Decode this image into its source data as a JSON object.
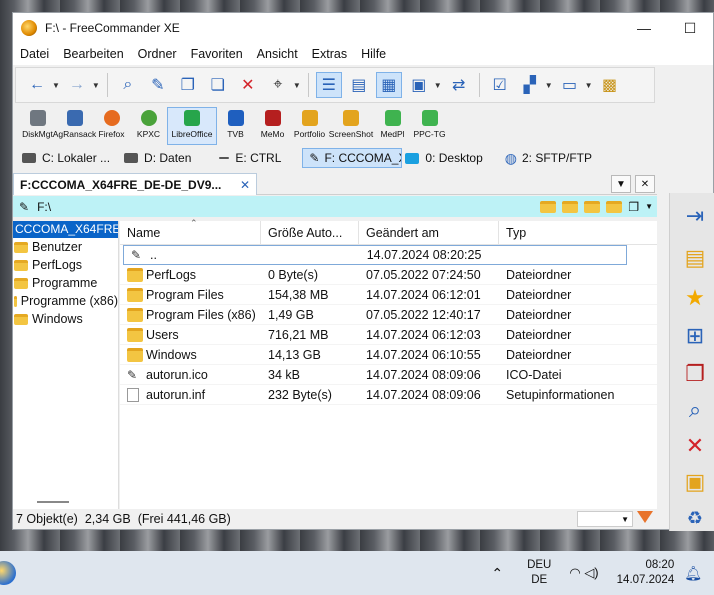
{
  "window": {
    "title": "F:\\ - FreeCommander XE",
    "min": "—",
    "max": "☐"
  },
  "menu": [
    "Datei",
    "Bearbeiten",
    "Ordner",
    "Favoriten",
    "Ansicht",
    "Extras",
    "Hilfe"
  ],
  "plugins": [
    {
      "label": "DiskMgt",
      "color": "#6f7780"
    },
    {
      "label": "AgRansack",
      "color": "#3a6ab0"
    },
    {
      "label": "Firefox",
      "color": "#e66b1f"
    },
    {
      "label": "KPXC",
      "color": "#4aa23a"
    },
    {
      "label": "LibreOffice",
      "color": "#27a54b"
    },
    {
      "label": "TVB",
      "color": "#1f5fbf"
    },
    {
      "label": "MeMo",
      "color": "#b51f1f"
    },
    {
      "label": "Portfolio",
      "color": "#e3a41e"
    },
    {
      "label": "ScreenShot",
      "color": "#e3a41e"
    },
    {
      "label": "MedPl",
      "color": "#3fb34f"
    },
    {
      "label": "PPC-TG",
      "color": "#3fb34f"
    }
  ],
  "drives": [
    {
      "label": "C: Lokaler ..."
    },
    {
      "label": "D: Daten"
    },
    {
      "label": "E: CTRL"
    },
    {
      "label": "F: CCCOMA_X64FRE"
    },
    {
      "label": "0: Desktop"
    },
    {
      "label": "2: SFTP/FTP"
    }
  ],
  "tab": {
    "label": "F:CCCOMA_X64FRE_DE-DE_DV9...",
    "close": "✕"
  },
  "path": "F:\\",
  "tree": {
    "root": "CCCOMA_X64FRE",
    "nodes": [
      "Benutzer",
      "PerfLogs",
      "Programme",
      "Programme (x86)",
      "Windows"
    ]
  },
  "columns": [
    "Name",
    "Größe Auto...",
    "Geändert am",
    "Typ"
  ],
  "files": [
    {
      "name": "..",
      "size": "",
      "date": "14.07.2024 08:20:25",
      "type": "",
      "icon": "usb"
    },
    {
      "name": "PerfLogs",
      "size": "0 Byte(s)",
      "date": "07.05.2022 07:24:50",
      "type": "Dateiordner",
      "icon": "folder"
    },
    {
      "name": "Program Files",
      "size": "154,38 MB",
      "date": "14.07.2024 06:12:01",
      "type": "Dateiordner",
      "icon": "folder"
    },
    {
      "name": "Program Files (x86)",
      "size": "1,49 GB",
      "date": "07.05.2022 12:40:17",
      "type": "Dateiordner",
      "icon": "folder"
    },
    {
      "name": "Users",
      "size": "716,21 MB",
      "date": "14.07.2024 06:12:03",
      "type": "Dateiordner",
      "icon": "folder"
    },
    {
      "name": "Windows",
      "size": "14,13 GB",
      "date": "14.07.2024 06:10:55",
      "type": "Dateiordner",
      "icon": "folder"
    },
    {
      "name": "autorun.ico",
      "size": "34 kB",
      "date": "14.07.2024 08:09:06",
      "type": "ICO-Datei",
      "icon": "usb"
    },
    {
      "name": "autorun.inf",
      "size": "232 Byte(s)",
      "date": "14.07.2024 08:09:06",
      "type": "Setupinformationen",
      "icon": "doc"
    }
  ],
  "status": {
    "count": "7 Objekt(e)",
    "size": "2,34 GB",
    "free": "(Frei 441,46 GB)"
  },
  "taskbar": {
    "lang1": "DEU",
    "lang2": "DE",
    "time": "08:20",
    "date": "14.07.2024"
  }
}
